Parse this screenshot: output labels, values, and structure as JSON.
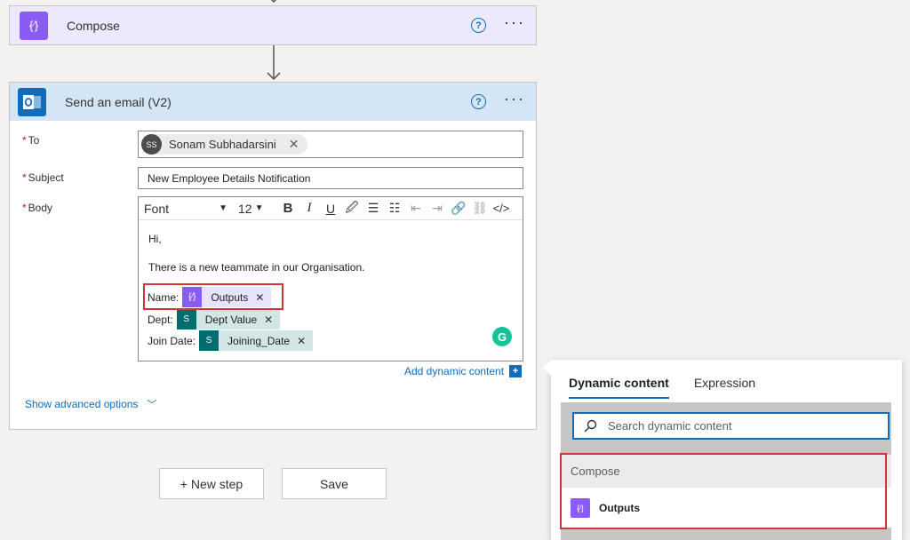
{
  "compose_action": {
    "title": "Compose"
  },
  "email_action": {
    "title": "Send an email (V2)",
    "to_label": "To",
    "to_recipient": {
      "initials": "SS",
      "name": "Sonam Subhadarsini"
    },
    "subject_label": "Subject",
    "subject_value": "New Employee Details Notification",
    "body_label": "Body",
    "toolbar": {
      "font": "Font",
      "size": "12"
    },
    "body": {
      "greeting": "Hi,",
      "line": "There is a new teammate in our Organisation.",
      "rows": [
        {
          "label": "Name:",
          "token": "Outputs"
        },
        {
          "label": "Dept:",
          "token": "Dept Value"
        },
        {
          "label": "Join Date:",
          "token": "Joining_Date"
        }
      ]
    },
    "add_dynamic_label": "Add dynamic content",
    "show_advanced_label": "Show advanced options"
  },
  "buttons": {
    "new_step": "+ New step",
    "save": "Save"
  },
  "dynamic_panel": {
    "tabs": [
      "Dynamic content",
      "Expression"
    ],
    "search_placeholder": "Search dynamic content",
    "section_title": "Compose",
    "item_label": "Outputs"
  },
  "colors": {
    "accent": "#0f6cbd",
    "compose": "#8a5cf6",
    "sharepoint": "#036c70",
    "highlight": "#d13438"
  }
}
